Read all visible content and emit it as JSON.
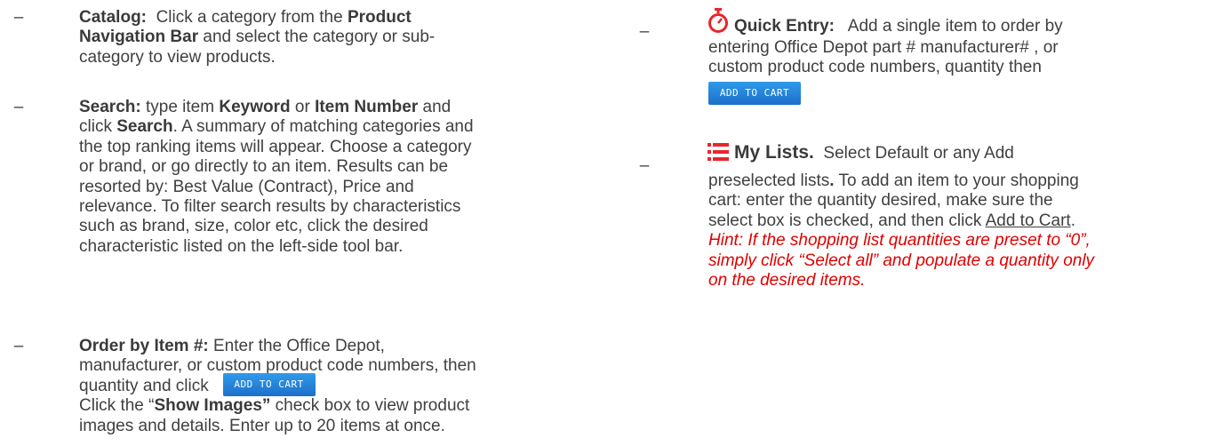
{
  "dash": "–",
  "left_items": {
    "catalog": {
      "label": "Catalog:",
      "l1_pre": "Click a category from the",
      "l1_bold": "Product",
      "l2_bold": "Navigation Bar",
      "l2_rest": "and select the category or sub-",
      "l3": "category to view products."
    },
    "search": {
      "label": "Search:",
      "l1_pre": "type item",
      "l1_bold1": "Keyword",
      "l1_mid": "or",
      "l1_bold2": "Item Number",
      "l1_post": "and",
      "l2_pre": "click",
      "l2_bold": "Search",
      "l2_post": ". A summary of matching categories and",
      "l3": "the top ranking items will appear. Choose a category",
      "l4": "or brand, or go directly to an item. Results can be",
      "l5": "resorted by: Best Value (Contract), Price and",
      "l6": "relevance. To filter search results by characteristics",
      "l7": "such as brand, size, color etc, click the desired",
      "l8": "characteristic listed on the left-side tool bar."
    },
    "order": {
      "label": "Order by Item #:",
      "l1_post": "Enter the Office Depot,",
      "l2": "manufacturer, or custom product code numbers, then",
      "l3": "quantity and click",
      "button": "ADD TO CART",
      "l4_pre": "Click the “",
      "l4_bold": "Show Images”",
      "l4_post": "check box to view product",
      "l5": "images and details.  Enter up to 20 items at once."
    }
  },
  "right_items": {
    "quick": {
      "label": "Quick Entry:",
      "l1_post": "Add a single item to order by",
      "l2": "entering Office Depot part #  manufacturer# , or",
      "l3": "custom product code numbers, quantity then",
      "button": "ADD TO CART",
      "icon": "stopwatch-icon"
    },
    "lists": {
      "label": "My Lists.",
      "l1_post": "Select Default or any  Add",
      "l2_pre": "preselected lists",
      "l2_bold": ".",
      "l2_post": "To add an item to your shopping",
      "l3": "cart:  enter the quantity desired, make sure the",
      "l4_pre": "select box is checked, and then click",
      "l4_link": "Add to Cart",
      "l4_post": ".",
      "hint1": "Hint:  If the shopping list quantities are preset to “0”,",
      "hint2": "simply click “Select all” and populate a quantity only",
      "hint3": "on the desired items.",
      "icon": "list-icon"
    }
  },
  "colors": {
    "text": "#404040",
    "hint": "#e00000",
    "button": "#1d6fc9",
    "icon": "#e8262d"
  }
}
